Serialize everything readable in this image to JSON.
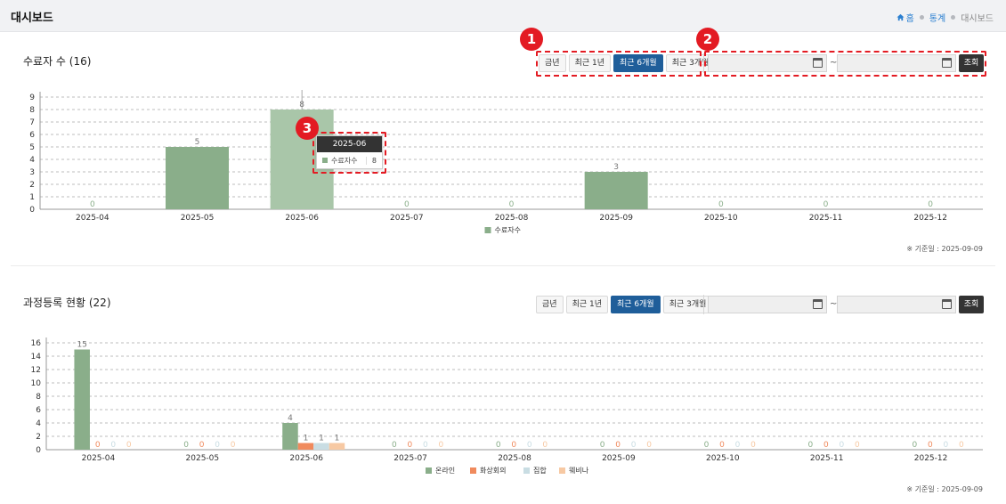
{
  "header": {
    "title": "대시보드",
    "breadcrumbs": [
      "홈",
      "통계",
      "대시보드"
    ]
  },
  "period_buttons": [
    "금년",
    "최근 1년",
    "최근 6개월",
    "최근 3개월"
  ],
  "active_period": "최근 6개월",
  "search_label": "조회",
  "range_separator": "~",
  "basis_date": "※ 기준일 : 2025-09-09",
  "markers": [
    "1",
    "2",
    "3"
  ],
  "tooltip": {
    "title": "2025-06",
    "series": "수료자수",
    "value": "8"
  },
  "colors": {
    "completion": "#8aae8a",
    "online": "#8aae8a",
    "video": "#f08a5d",
    "group": "#c9dde3",
    "webinar": "#f7c9a3",
    "accent": "#1f5e9a",
    "highlight": "#e31b23"
  },
  "chart_data": [
    {
      "type": "bar",
      "title": "수료자 수 (16)",
      "categories": [
        "2025-04",
        "2025-05",
        "2025-06",
        "2025-07",
        "2025-08",
        "2025-09",
        "2025-10",
        "2025-11",
        "2025-12"
      ],
      "series": [
        {
          "name": "수료자수",
          "values": [
            0,
            5,
            8,
            0,
            0,
            3,
            0,
            0,
            0
          ]
        }
      ],
      "ylim": [
        0,
        9
      ],
      "yticks": [
        0,
        1,
        2,
        3,
        4,
        5,
        6,
        7,
        8,
        9
      ],
      "grid": true,
      "legend": "bottom"
    },
    {
      "type": "bar",
      "title": "과정등록 현황 (22)",
      "categories": [
        "2025-04",
        "2025-05",
        "2025-06",
        "2025-07",
        "2025-08",
        "2025-09",
        "2025-10",
        "2025-11",
        "2025-12"
      ],
      "series": [
        {
          "name": "온라인",
          "values": [
            15,
            0,
            4,
            0,
            0,
            0,
            0,
            0,
            0
          ]
        },
        {
          "name": "화상회의",
          "values": [
            0,
            0,
            1,
            0,
            0,
            0,
            0,
            0,
            0
          ]
        },
        {
          "name": "집합",
          "values": [
            0,
            0,
            1,
            0,
            0,
            0,
            0,
            0,
            0
          ]
        },
        {
          "name": "웨비나",
          "values": [
            0,
            0,
            1,
            0,
            0,
            0,
            0,
            0,
            0
          ]
        }
      ],
      "ylim": [
        0,
        16
      ],
      "yticks": [
        0,
        2,
        4,
        6,
        8,
        10,
        12,
        14,
        16
      ],
      "grid": true,
      "legend": "bottom"
    }
  ]
}
